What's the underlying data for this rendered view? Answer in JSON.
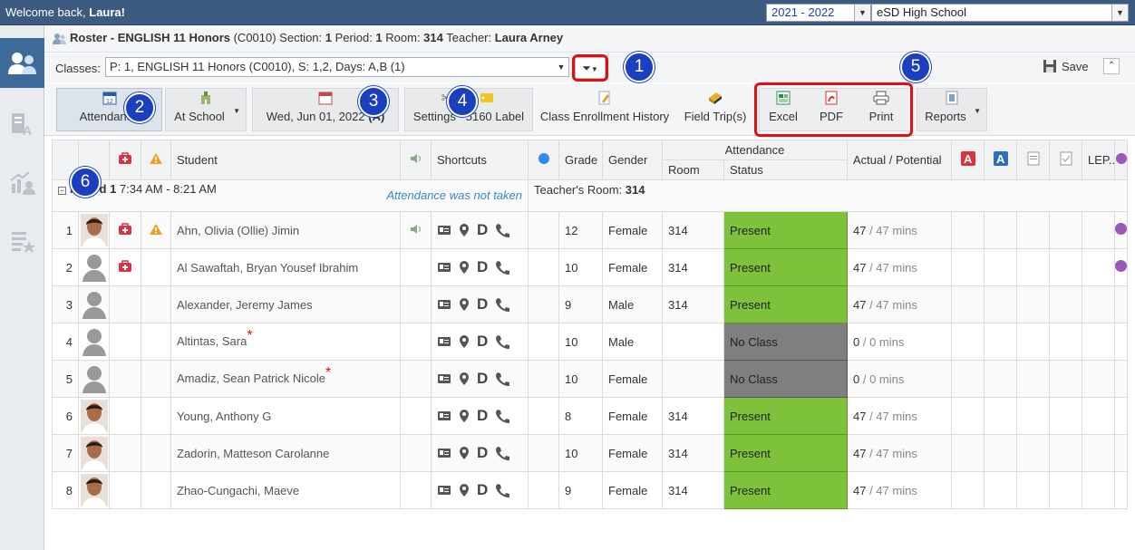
{
  "topbar": {
    "welcome_prefix": "Welcome back, ",
    "user": "Laura!",
    "year": "2021 - 2022",
    "school": "eSD High School"
  },
  "title": {
    "prefix": "Roster - ",
    "course": "ENGLISH 11 Honors",
    "code": " (C0010) Section: ",
    "section": "1",
    "period_label": " Period: ",
    "period": "1",
    "room_label": " Room: ",
    "room": "314",
    "teacher_label": " Teacher: ",
    "teacher": "Laura Arney"
  },
  "classes": {
    "label": "Classes:",
    "value": "P: 1, ENGLISH 11 Honors (C0010), S: 1,2, Days: A,B (1)"
  },
  "save_label": "Save",
  "toolbar": {
    "attendance": "Attendance",
    "at_school": "At School",
    "date": "Wed, Jun 01, 2022",
    "date_suffix": "(A)",
    "settings": "Settings",
    "label5160": "5160 Label",
    "class_enroll": "Class Enrollment History",
    "field_trips": "Field Trip(s)",
    "excel": "Excel",
    "pdf": "PDF",
    "print": "Print",
    "reports": "Reports"
  },
  "badges": [
    "1",
    "2",
    "3",
    "4",
    "5",
    "6"
  ],
  "headers": {
    "student": "Student",
    "shortcuts": "Shortcuts",
    "grade": "Grade",
    "gender": "Gender",
    "attendance": "Attendance",
    "room": "Room",
    "status": "Status",
    "actual": "Actual / Potential",
    "lep": "LEP.."
  },
  "period": {
    "label": "Period 1",
    "time": "7:34 AM - 8:21 AM",
    "note": "Attendance was not taken",
    "teacher_room_label": "Teacher's Room: ",
    "teacher_room": "314"
  },
  "students": [
    {
      "n": "1",
      "name": "Ahn, Olivia (Ollie) Jimin",
      "grade": "12",
      "gender": "Female",
      "room": "314",
      "status": "Present",
      "actual": "47",
      "potential": " / 47 mins"
    },
    {
      "n": "2",
      "name": "Al Sawaftah, Bryan Yousef Ibrahim",
      "grade": "10",
      "gender": "Female",
      "room": "314",
      "status": "Present",
      "actual": "47",
      "potential": " / 47 mins"
    },
    {
      "n": "3",
      "name": "Alexander, Jeremy James",
      "grade": "9",
      "gender": "Male",
      "room": "314",
      "status": "Present",
      "actual": "47",
      "potential": " / 47 mins"
    },
    {
      "n": "4",
      "name": "Altintas, Sara",
      "grade": "10",
      "gender": "Male",
      "room": "",
      "status": "No Class",
      "actual": "0",
      "potential": " / 0 mins"
    },
    {
      "n": "5",
      "name": "Amadiz, Sean Patrick Nicole",
      "grade": "10",
      "gender": "Female",
      "room": "",
      "status": "No Class",
      "actual": "0",
      "potential": " / 0 mins"
    },
    {
      "n": "6",
      "name": "Young, Anthony G",
      "grade": "8",
      "gender": "Female",
      "room": "314",
      "status": "Present",
      "actual": "47",
      "potential": " / 47 mins"
    },
    {
      "n": "7",
      "name": "Zadorin, Matteson Carolanne",
      "grade": "10",
      "gender": "Female",
      "room": "314",
      "status": "Present",
      "actual": "47",
      "potential": " / 47 mins"
    },
    {
      "n": "8",
      "name": "Zhao-Cungachi, Maeve",
      "grade": "9",
      "gender": "Female",
      "room": "314",
      "status": "Present",
      "actual": "47",
      "potential": " / 47 mins"
    }
  ],
  "shortcut_d": "D",
  "star": "*",
  "colors": {
    "present": "#7dc23a",
    "no_class": "#7f7f7f",
    "badge": "#1a3fbf",
    "highlight": "#e01010"
  }
}
